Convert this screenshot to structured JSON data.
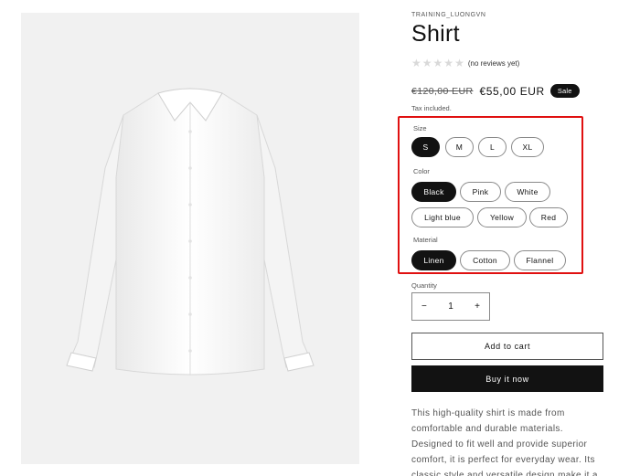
{
  "product": {
    "vendor": "TRAINING_LUONGVN",
    "title": "Shirt",
    "rating": {
      "stars": 0,
      "max_stars": 5,
      "text": "(no reviews yet)"
    },
    "price": {
      "compare_at": "€120,00 EUR",
      "sale": "€55,00 EUR",
      "badge": "Sale"
    },
    "tax_note": "Tax included.",
    "image": {
      "subject": "white long-sleeve dress shirt",
      "background": "#f1f1f1"
    }
  },
  "variants": {
    "size": {
      "label": "Size",
      "options": [
        "S",
        "M",
        "L",
        "XL"
      ],
      "selected": "S"
    },
    "color": {
      "label": "Color",
      "options": [
        "Black",
        "Pink",
        "White",
        "Light blue",
        "Yellow",
        "Red"
      ],
      "selected": "Black"
    },
    "material": {
      "label": "Material",
      "options": [
        "Linen",
        "Cotton",
        "Flannel"
      ],
      "selected": "Linen"
    },
    "highlight_color": "#e01010"
  },
  "quantity": {
    "label": "Quantity",
    "value": "1",
    "decrement": "−",
    "increment": "+"
  },
  "buttons": {
    "add_to_cart": "Add to cart",
    "buy_now": "Buy it now"
  },
  "description": "This high-quality shirt is made from comfortable and durable materials. Designed to fit well and provide superior comfort, it is perfect for everyday wear. Its classic style and versatile design make it a staple piece in any"
}
